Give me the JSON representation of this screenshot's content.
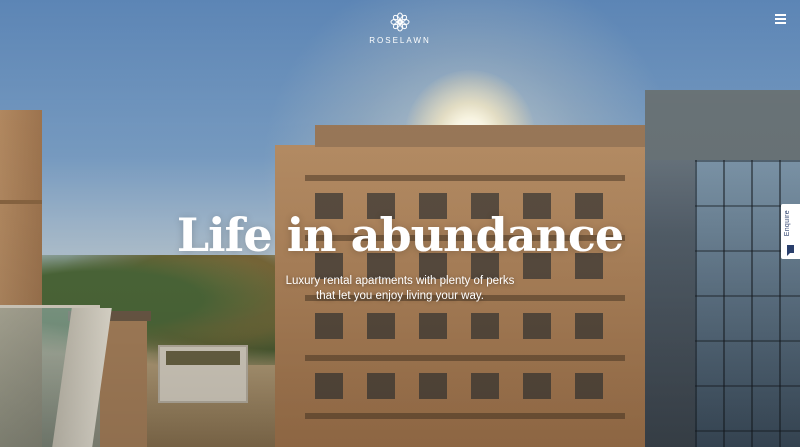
{
  "header": {
    "logo_icon": "flower-icon",
    "logo_text": "ROSELAWN",
    "menu_icon": "hamburger-menu-icon"
  },
  "hero": {
    "headline": "Life in abundance",
    "subline_1": "Luxury rental apartments with plenty of perks",
    "subline_2": "that let you enjoy living your way."
  },
  "enquire": {
    "label": "Enquire",
    "icon": "chat-bubble-icon",
    "color": "#2a3f6c"
  }
}
